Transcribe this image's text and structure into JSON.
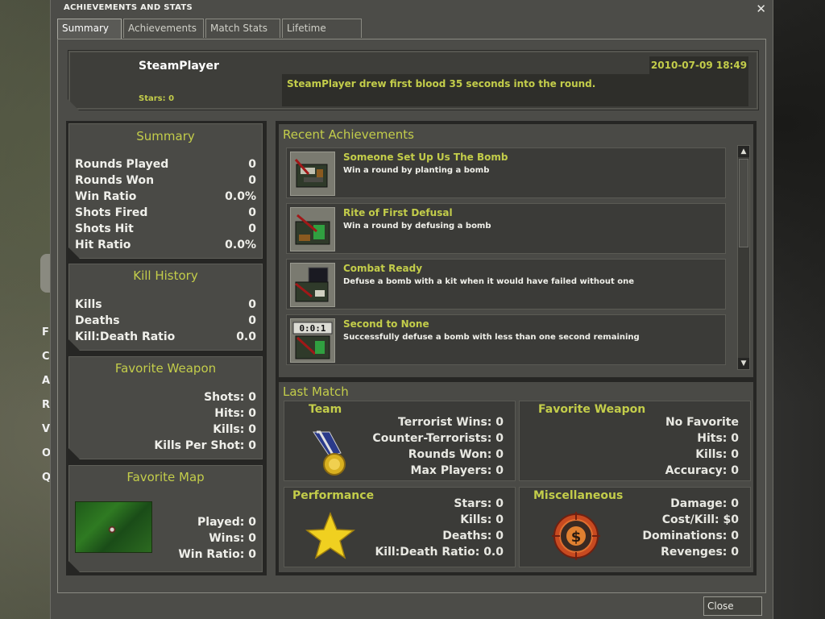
{
  "background": {
    "menu_items": [
      "F",
      "C",
      "A",
      "R",
      "V",
      "O",
      "Q"
    ]
  },
  "dialog": {
    "title": "ACHIEVEMENTS AND STATS",
    "close_glyph": "✕",
    "tabs": [
      {
        "label": "Summary",
        "active": true
      },
      {
        "label": "Achievements",
        "active": false
      },
      {
        "label": "Match Stats",
        "active": false
      },
      {
        "label": "Lifetime Stats",
        "active": false
      }
    ],
    "close_button": "Close"
  },
  "header": {
    "player_name": "SteamPlayer",
    "stars": "Stars: 0",
    "datetime": "2010-07-09 18:49",
    "message": "SteamPlayer drew first blood 35 seconds into the round."
  },
  "summary": {
    "title": "Summary",
    "rows": [
      {
        "label": "Rounds Played",
        "value": "0"
      },
      {
        "label": "Rounds Won",
        "value": "0"
      },
      {
        "label": "Win Ratio",
        "value": "0.0%"
      },
      {
        "label": "Shots Fired",
        "value": "0"
      },
      {
        "label": "Shots Hit",
        "value": "0"
      },
      {
        "label": "Hit Ratio",
        "value": "0.0%"
      }
    ]
  },
  "kill_history": {
    "title": "Kill History",
    "rows": [
      {
        "label": "Kills",
        "value": "0"
      },
      {
        "label": "Deaths",
        "value": "0"
      },
      {
        "label": "Kill:Death Ratio",
        "value": "0.0"
      }
    ]
  },
  "favorite_weapon": {
    "title": "Favorite Weapon",
    "rows": [
      {
        "label": "Shots: ",
        "value": "0"
      },
      {
        "label": "Hits: ",
        "value": "0"
      },
      {
        "label": "Kills: ",
        "value": "0"
      },
      {
        "label": "Kills Per Shot: ",
        "value": "0"
      }
    ]
  },
  "favorite_map": {
    "title": "Favorite Map",
    "rows": [
      {
        "label": "Played: ",
        "value": "0"
      },
      {
        "label": "Wins: ",
        "value": "0"
      },
      {
        "label": "Win Ratio: ",
        "value": "0"
      }
    ]
  },
  "recent_achievements": {
    "title": "Recent Achievements",
    "items": [
      {
        "name": "Someone Set Up Us The Bomb",
        "description": "Win a round by planting a bomb",
        "icon": "bomb-plant-icon"
      },
      {
        "name": "Rite of First Defusal",
        "description": "Win a round by defusing a bomb",
        "icon": "bomb-defuse-icon"
      },
      {
        "name": "Combat Ready",
        "description": "Defuse a bomb with a kit when it would have failed without one",
        "icon": "defuse-kit-icon"
      },
      {
        "name": "Second to None",
        "description": "Successfully defuse a bomb with less than one second remaining",
        "icon": "bomb-timer-icon",
        "icon_text": "0:0:1"
      }
    ]
  },
  "last_match": {
    "title": "Last Match",
    "team": {
      "title": "Team",
      "rows": [
        {
          "label": "Terrorist Wins: ",
          "value": "0"
        },
        {
          "label": "Counter-Terrorists: ",
          "value": "0"
        },
        {
          "label": "Rounds Won: ",
          "value": "0"
        },
        {
          "label": "Max Players: ",
          "value": "0"
        }
      ]
    },
    "favorite_weapon": {
      "title": "Favorite Weapon",
      "rows": [
        {
          "label": "No Favorite",
          "value": ""
        },
        {
          "label": "Hits: ",
          "value": "0"
        },
        {
          "label": "Kills: ",
          "value": "0"
        },
        {
          "label": "Accuracy: ",
          "value": "0"
        }
      ]
    },
    "performance": {
      "title": "Performance",
      "rows": [
        {
          "label": "Stars: ",
          "value": "0"
        },
        {
          "label": "Kills: ",
          "value": "0"
        },
        {
          "label": "Deaths: ",
          "value": "0"
        },
        {
          "label": "Kill:Death Ratio: ",
          "value": "0.0"
        }
      ]
    },
    "miscellaneous": {
      "title": "Miscellaneous",
      "rows": [
        {
          "label": "Damage: ",
          "value": "0"
        },
        {
          "label": "Cost/Kill: ",
          "value": "$0"
        },
        {
          "label": "Dominations: ",
          "value": "0"
        },
        {
          "label": "Revenges: ",
          "value": "0"
        }
      ]
    }
  },
  "colors": {
    "accent": "#c3cd4a",
    "panel": "#4a4a46",
    "dark": "#262624"
  }
}
